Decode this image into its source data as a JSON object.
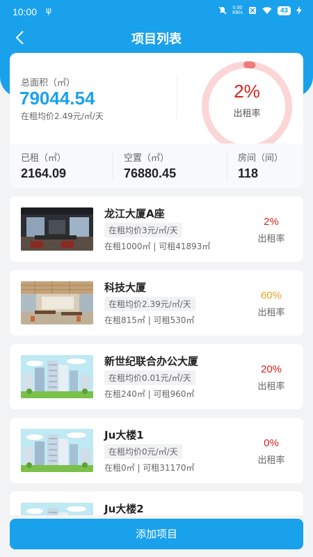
{
  "status": {
    "time": "10:00",
    "usb": "ψ",
    "speed_top": "0.00",
    "speed_bottom": "KB/s",
    "battery": "43"
  },
  "header": {
    "title": "项目列表",
    "back_icon": "chevron-left-icon"
  },
  "summary": {
    "total_area_label": "总面积（㎡）",
    "total_area": "79044.54",
    "avg_price": "在租均价2.49元/㎡/天",
    "occupancy_pct": "2%",
    "occupancy_label": "出租率",
    "occupancy_value": 0.02,
    "stats": [
      {
        "label": "已租（㎡）",
        "value": "2164.09"
      },
      {
        "label": "空置（㎡）",
        "value": "76880.45"
      },
      {
        "label": "房间（间）",
        "value": "118"
      }
    ]
  },
  "colors": {
    "accent": "#1aa1ec",
    "low": "#d9201c",
    "mid": "#f0a020"
  },
  "projects": [
    {
      "name": "龙江大厦A座",
      "price": "在租均价3元/㎡/天",
      "detail": "在租1000㎡ | 可租41893㎡",
      "pct": "2%",
      "pct_label": "出租率",
      "pct_color": "#d9201c",
      "thumb": "office-photo"
    },
    {
      "name": "科技大厦",
      "price": "在租均价2.39元/㎡/天",
      "detail": "在租815㎡ | 可租530㎡",
      "pct": "60%",
      "pct_label": "出租率",
      "pct_color": "#f0a020",
      "thumb": "office-photo-2"
    },
    {
      "name": "新世纪联合办公大厦",
      "price": "在租均价0.01元/㎡/天",
      "detail": "在租240㎡ | 可租960㎡",
      "pct": "20%",
      "pct_label": "出租率",
      "pct_color": "#d9201c",
      "thumb": "building-illustration"
    },
    {
      "name": "Ju大楼1",
      "price": "在租均价0元/㎡/天",
      "detail": "在租0㎡ | 可租31170㎡",
      "pct": "0%",
      "pct_label": "出租率",
      "pct_color": "#d9201c",
      "thumb": "building-illustration"
    },
    {
      "name": "Ju大楼2",
      "price": "",
      "detail": "",
      "pct": "",
      "pct_label": "",
      "pct_color": "#d9201c",
      "thumb": "building-illustration"
    }
  ],
  "add_button": "添加项目"
}
